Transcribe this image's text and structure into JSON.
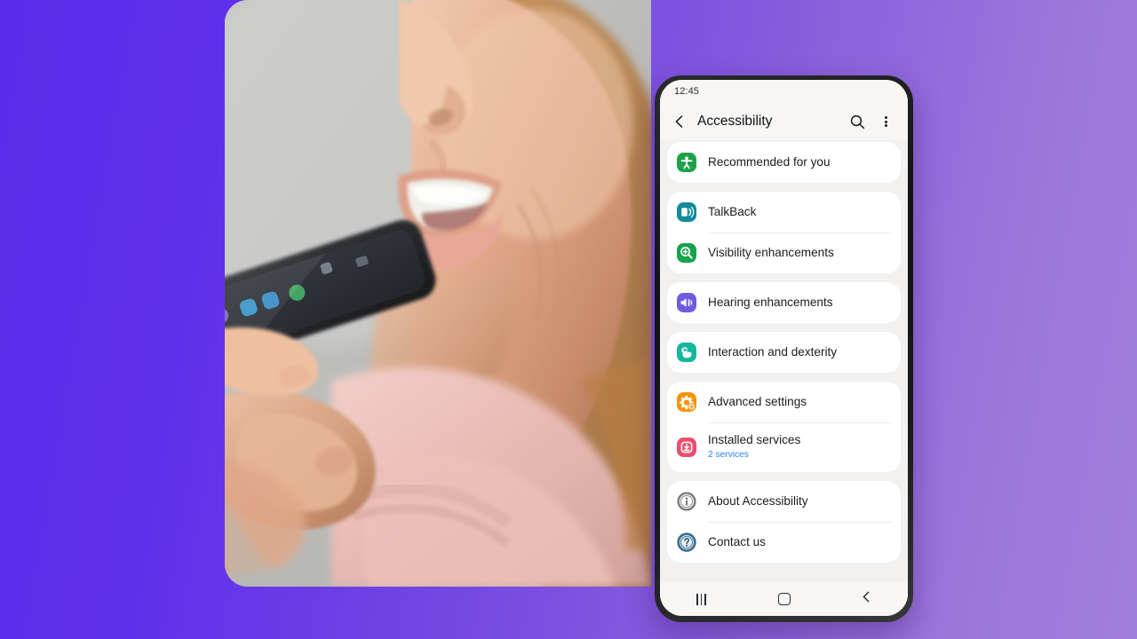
{
  "background": {
    "gradient_from": "#5B2BEB",
    "gradient_to": "#A27EDC"
  },
  "hero_photo": {
    "alt": "Woman speaking into a smartphone held near her mouth",
    "description": "Close-up photo of a person's lower face and hand holding a black smartphone up toward her mouth, light gray background"
  },
  "phone": {
    "status_bar": {
      "time": "12:45"
    },
    "title_bar": {
      "back_label": "Back",
      "title": "Accessibility",
      "search_label": "Search",
      "more_label": "More options"
    },
    "groups": [
      {
        "id": "recommended",
        "items": [
          {
            "label": "Recommended for you",
            "sublabel": "",
            "icon": "accessibility-person-icon",
            "icon_color": "#1CA14A"
          }
        ]
      },
      {
        "id": "vision",
        "items": [
          {
            "label": "TalkBack",
            "sublabel": "",
            "icon": "talkback-speaker-icon",
            "icon_color": "#128B99"
          },
          {
            "label": "Visibility enhancements",
            "sublabel": "",
            "icon": "magnifier-plus-icon",
            "icon_color": "#16A34A"
          }
        ]
      },
      {
        "id": "hearing",
        "items": [
          {
            "label": "Hearing enhancements",
            "sublabel": "",
            "icon": "hearing-speaker-icon",
            "icon_color": "#6D5BE0"
          }
        ]
      },
      {
        "id": "interaction",
        "items": [
          {
            "label": "Interaction and dexterity",
            "sublabel": "",
            "icon": "hand-tap-icon",
            "icon_color": "#15B79E"
          }
        ]
      },
      {
        "id": "advanced",
        "items": [
          {
            "label": "Advanced settings",
            "sublabel": "",
            "icon": "gear-plus-icon",
            "icon_color": "#F59307"
          },
          {
            "label": "Installed services",
            "sublabel": "2 services",
            "icon": "installed-services-icon",
            "icon_color": "#EE4D6E"
          }
        ]
      },
      {
        "id": "info",
        "items": [
          {
            "label": "About Accessibility",
            "sublabel": "",
            "icon": "info-circle-icon",
            "icon_color": "#7B7B7B"
          },
          {
            "label": "Contact us",
            "sublabel": "",
            "icon": "question-circle-icon",
            "icon_color": "#3D6E8E"
          }
        ]
      }
    ],
    "nav_bar": {
      "recents_label": "Recents",
      "home_label": "Home",
      "back_label": "Back"
    }
  }
}
